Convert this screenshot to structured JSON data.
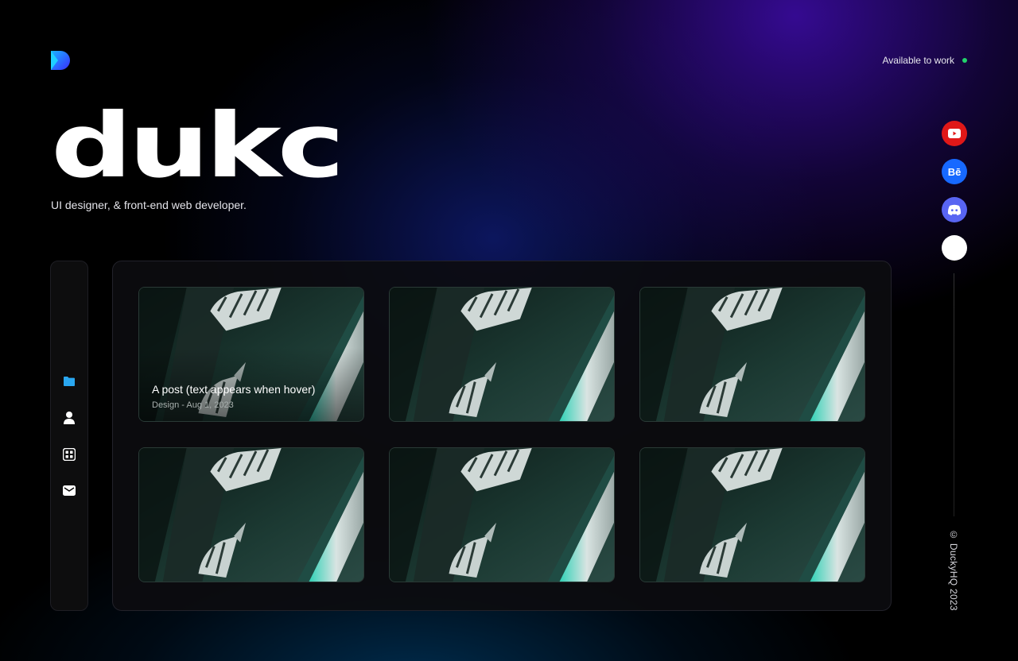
{
  "header": {
    "logo": "dukc-logo-icon",
    "availability_text": "Available to work",
    "availability_color": "#22d36b"
  },
  "hero": {
    "brand": "dukc",
    "tagline": "UI designer, & front-end web developer."
  },
  "social": [
    {
      "name": "youtube-icon",
      "color": "#e01818"
    },
    {
      "name": "behance-icon",
      "label": "Bē",
      "color": "#1769ff"
    },
    {
      "name": "discord-icon",
      "color": "#5865f2"
    },
    {
      "name": "extra-social-icon",
      "color": "#ffffff"
    }
  ],
  "footer": {
    "copyright": "© DuckyHQ 2023"
  },
  "sidebar": {
    "items": [
      {
        "icon": "folder-icon",
        "active": true,
        "color": "#2aa7f0"
      },
      {
        "icon": "user-icon",
        "active": false
      },
      {
        "icon": "grid-icon",
        "active": false
      },
      {
        "icon": "mail-icon",
        "active": false
      }
    ]
  },
  "gallery": {
    "cards": [
      {
        "title": "A post (text appears when hover)",
        "meta": "Design - Aug 1, 2023"
      },
      {
        "title": "",
        "meta": ""
      },
      {
        "title": "",
        "meta": ""
      },
      {
        "title": "",
        "meta": ""
      },
      {
        "title": "",
        "meta": ""
      },
      {
        "title": "",
        "meta": ""
      }
    ]
  }
}
